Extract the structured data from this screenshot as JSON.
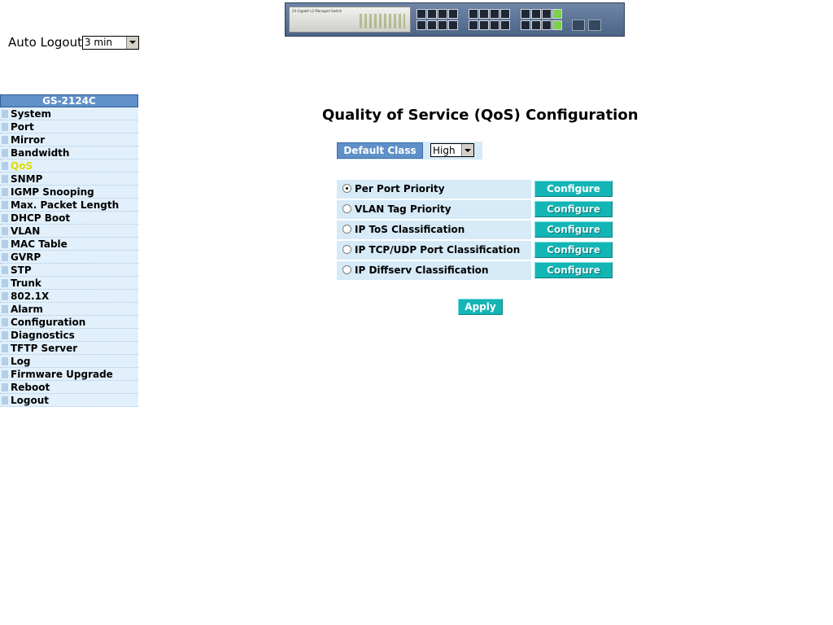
{
  "header": {
    "banner_text": "24-Gigabit L2 Managed Switch",
    "auto_logout_label": "Auto Logout",
    "auto_logout_value": "3 min"
  },
  "sidebar": {
    "title": "GS-2124C",
    "items": [
      {
        "label": "System"
      },
      {
        "label": "Port"
      },
      {
        "label": "Mirror"
      },
      {
        "label": "Bandwidth"
      },
      {
        "label": "QoS",
        "active": true
      },
      {
        "label": "SNMP"
      },
      {
        "label": "IGMP Snooping"
      },
      {
        "label": "Max. Packet Length"
      },
      {
        "label": "DHCP Boot"
      },
      {
        "label": "VLAN"
      },
      {
        "label": "MAC Table"
      },
      {
        "label": "GVRP"
      },
      {
        "label": "STP"
      },
      {
        "label": "Trunk"
      },
      {
        "label": "802.1X"
      },
      {
        "label": "Alarm"
      },
      {
        "label": "Configuration"
      },
      {
        "label": "Diagnostics"
      },
      {
        "label": "TFTP Server"
      },
      {
        "label": "Log"
      },
      {
        "label": "Firmware Upgrade"
      },
      {
        "label": "Reboot"
      },
      {
        "label": "Logout"
      }
    ]
  },
  "main": {
    "title": "Quality of Service (QoS) Configuration",
    "default_class_label": "Default Class",
    "default_class_value": "High",
    "options": [
      {
        "label": "Per Port Priority",
        "checked": true,
        "button": "Configure",
        "enabled": true
      },
      {
        "label": "VLAN Tag Priority",
        "checked": false,
        "button": "Configure",
        "enabled": false
      },
      {
        "label": "IP ToS Classification",
        "checked": false,
        "button": "Configure",
        "enabled": false
      },
      {
        "label": "IP TCP/UDP Port Classification",
        "checked": false,
        "button": "Configure",
        "enabled": false
      },
      {
        "label": "IP Diffserv Classification",
        "checked": false,
        "button": "Configure",
        "enabled": false
      }
    ],
    "apply_label": "Apply"
  },
  "colors": {
    "sidebar_title_bg": "#5f91c8",
    "sidebar_item_bg": "#e2f0fb",
    "active_item": "#dddd00",
    "button_bg": "#13b5b5",
    "option_bg": "#d6eaf8"
  }
}
